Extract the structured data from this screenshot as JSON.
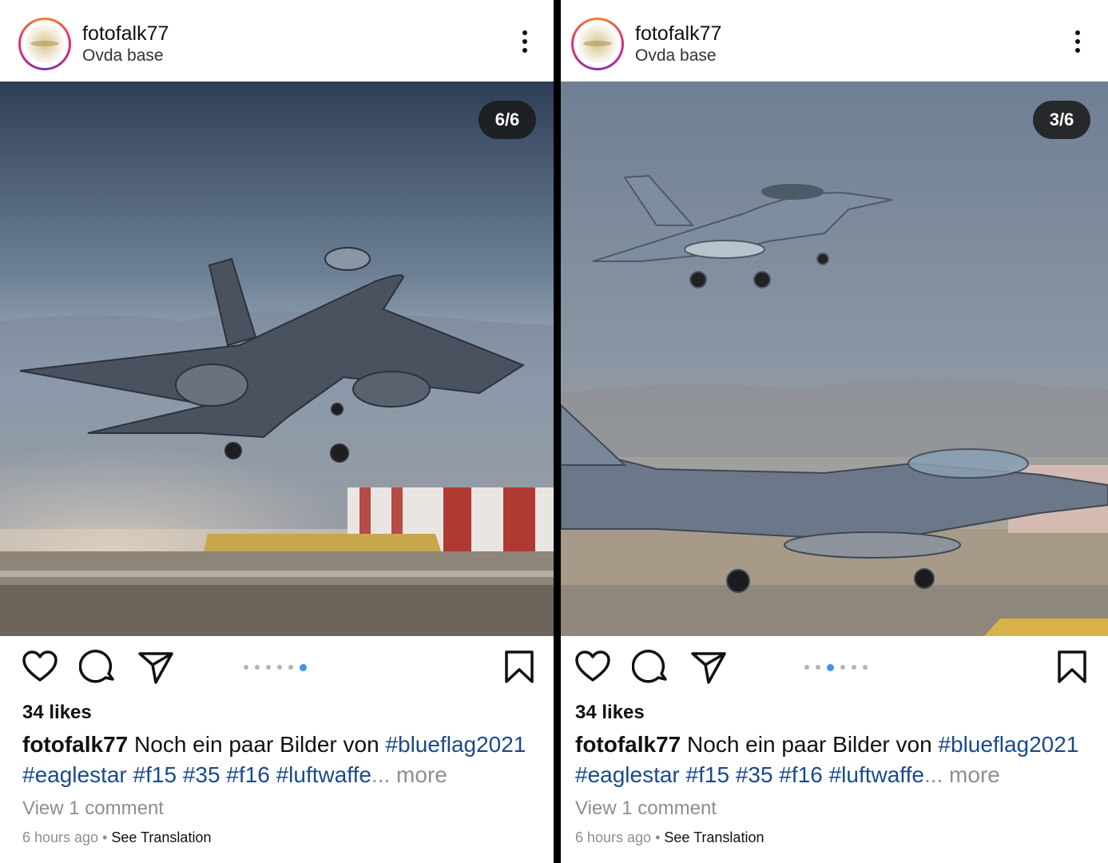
{
  "posts": [
    {
      "username": "fotofalk77",
      "location": "Ovda base",
      "counter": "6/6",
      "likes": "34 likes",
      "caption_user": "fotofalk77",
      "caption_text": " Noch ein paar Bilder von ",
      "caption_tag1": "#blueflag2021",
      "caption_tags2": "#eaglestar #f15 #35 #f16 #luftwaffe",
      "caption_more": "... more",
      "view_comments": "View 1 comment",
      "time": "6 hours ago",
      "separator": " • ",
      "translate": "See Translation",
      "active_slide": 6,
      "total_slides": 6
    },
    {
      "username": "fotofalk77",
      "location": "Ovda base",
      "counter": "3/6",
      "likes": "34 likes",
      "caption_user": "fotofalk77",
      "caption_text": " Noch ein paar Bilder von ",
      "caption_tag1": "#blueflag2021",
      "caption_tags2": "#eaglestar #f15 #35 #f16 #luftwaffe",
      "caption_more": "... more",
      "view_comments": "View 1 comment",
      "time": "6 hours ago",
      "separator": " • ",
      "translate": "See Translation",
      "active_slide": 3,
      "total_slides": 6
    }
  ],
  "icons": [
    "heart-icon",
    "comment-icon",
    "share-icon",
    "bookmark-icon",
    "more-options-icon"
  ],
  "colors": {
    "hashtag": "#1a4a8a",
    "muted": "#8e8e8e",
    "dot_active": "#3897f0",
    "divider": "#000000"
  }
}
